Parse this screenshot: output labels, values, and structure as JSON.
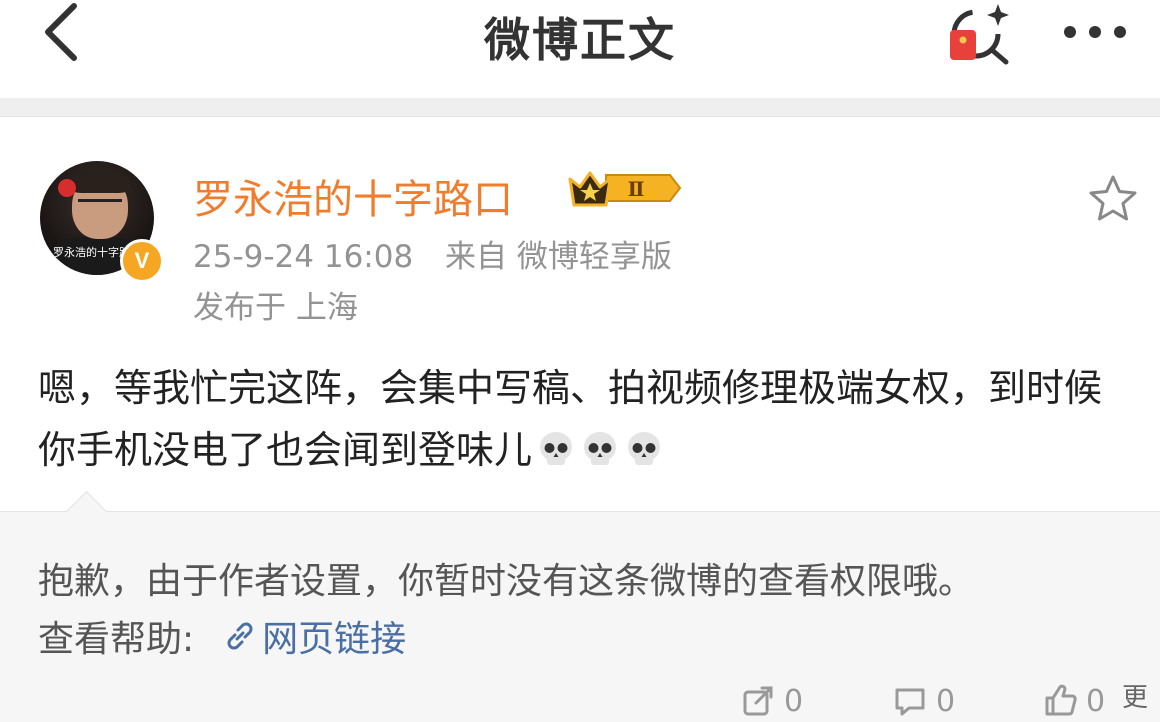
{
  "header": {
    "title": "微博正文"
  },
  "post": {
    "author": "罗永浩的十字路口",
    "avatar_caption": "罗永浩的十字路口",
    "verified_mark": "V",
    "member_level": "Ⅱ",
    "time": "25-9-24 16:08",
    "source": "来自 微博轻享版",
    "location": "发布于 上海",
    "text": "嗯，等我忙完这阵，会集中写稿、拍视频修理极端女权，到时候你手机没电了也会闻到登味儿",
    "emoji_count": 3
  },
  "notice": {
    "message": "抱歉，由于作者设置，你暂时没有这条微博的查看权限哦。",
    "help_label": "查看帮助:",
    "help_link": "网页链接"
  },
  "actions": {
    "repost_count": "0",
    "comment_count": "0",
    "like_count": "0",
    "trailing_char": "更"
  },
  "colors": {
    "username": "#f07c2c",
    "link": "#4a6fa5",
    "verified": "#f5a623"
  },
  "icons": [
    "back-icon",
    "red-packet-search-icon",
    "more-icon",
    "star-icon",
    "skull-emoji",
    "link-icon",
    "repost-icon",
    "comment-icon",
    "like-icon"
  ]
}
